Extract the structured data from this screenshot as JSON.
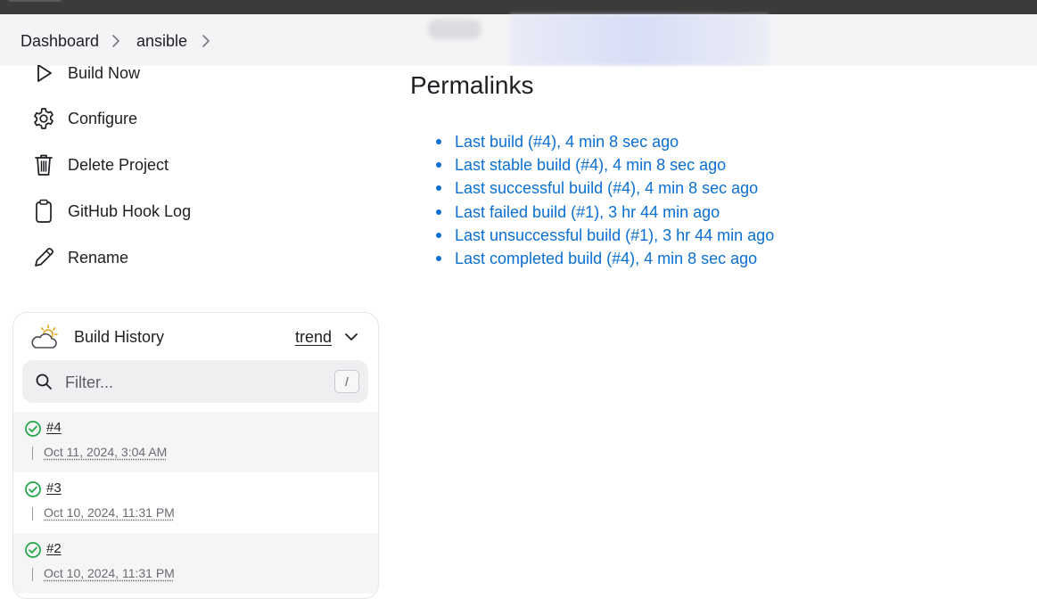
{
  "breadcrumb": {
    "items": [
      "Dashboard",
      "ansible"
    ]
  },
  "sidebar": {
    "items": [
      {
        "label": "Build Now",
        "icon": "play-icon"
      },
      {
        "label": "Configure",
        "icon": "gear-icon"
      },
      {
        "label": "Delete Project",
        "icon": "trash-icon"
      },
      {
        "label": "GitHub Hook Log",
        "icon": "clipboard-icon"
      },
      {
        "label": "Rename",
        "icon": "pencil-icon"
      }
    ]
  },
  "permalinks": {
    "title": "Permalinks",
    "links": [
      "Last build (#4), 4 min 8 sec ago",
      "Last stable build (#4), 4 min 8 sec ago",
      "Last successful build (#4), 4 min 8 sec ago",
      "Last failed build (#1), 3 hr 44 min ago",
      "Last unsuccessful build (#1), 3 hr 44 min ago",
      "Last completed build (#4), 4 min 8 sec ago"
    ]
  },
  "build_history": {
    "title": "Build History",
    "trend_label": "trend",
    "filter_placeholder": "Filter...",
    "filter_shortcut": "/",
    "builds": [
      {
        "number": "#4",
        "date": "Oct 11, 2024, 3:04 AM",
        "status": "success"
      },
      {
        "number": "#3",
        "date": "Oct 10, 2024, 11:31 PM",
        "status": "success"
      },
      {
        "number": "#2",
        "date": "Oct 10, 2024, 11:31 PM",
        "status": "success"
      }
    ]
  },
  "colors": {
    "link": "#0b6fd2",
    "success": "#1ea446",
    "topbar": "#3b3b3b",
    "breadcrumb_bg": "#f4f4f6"
  }
}
